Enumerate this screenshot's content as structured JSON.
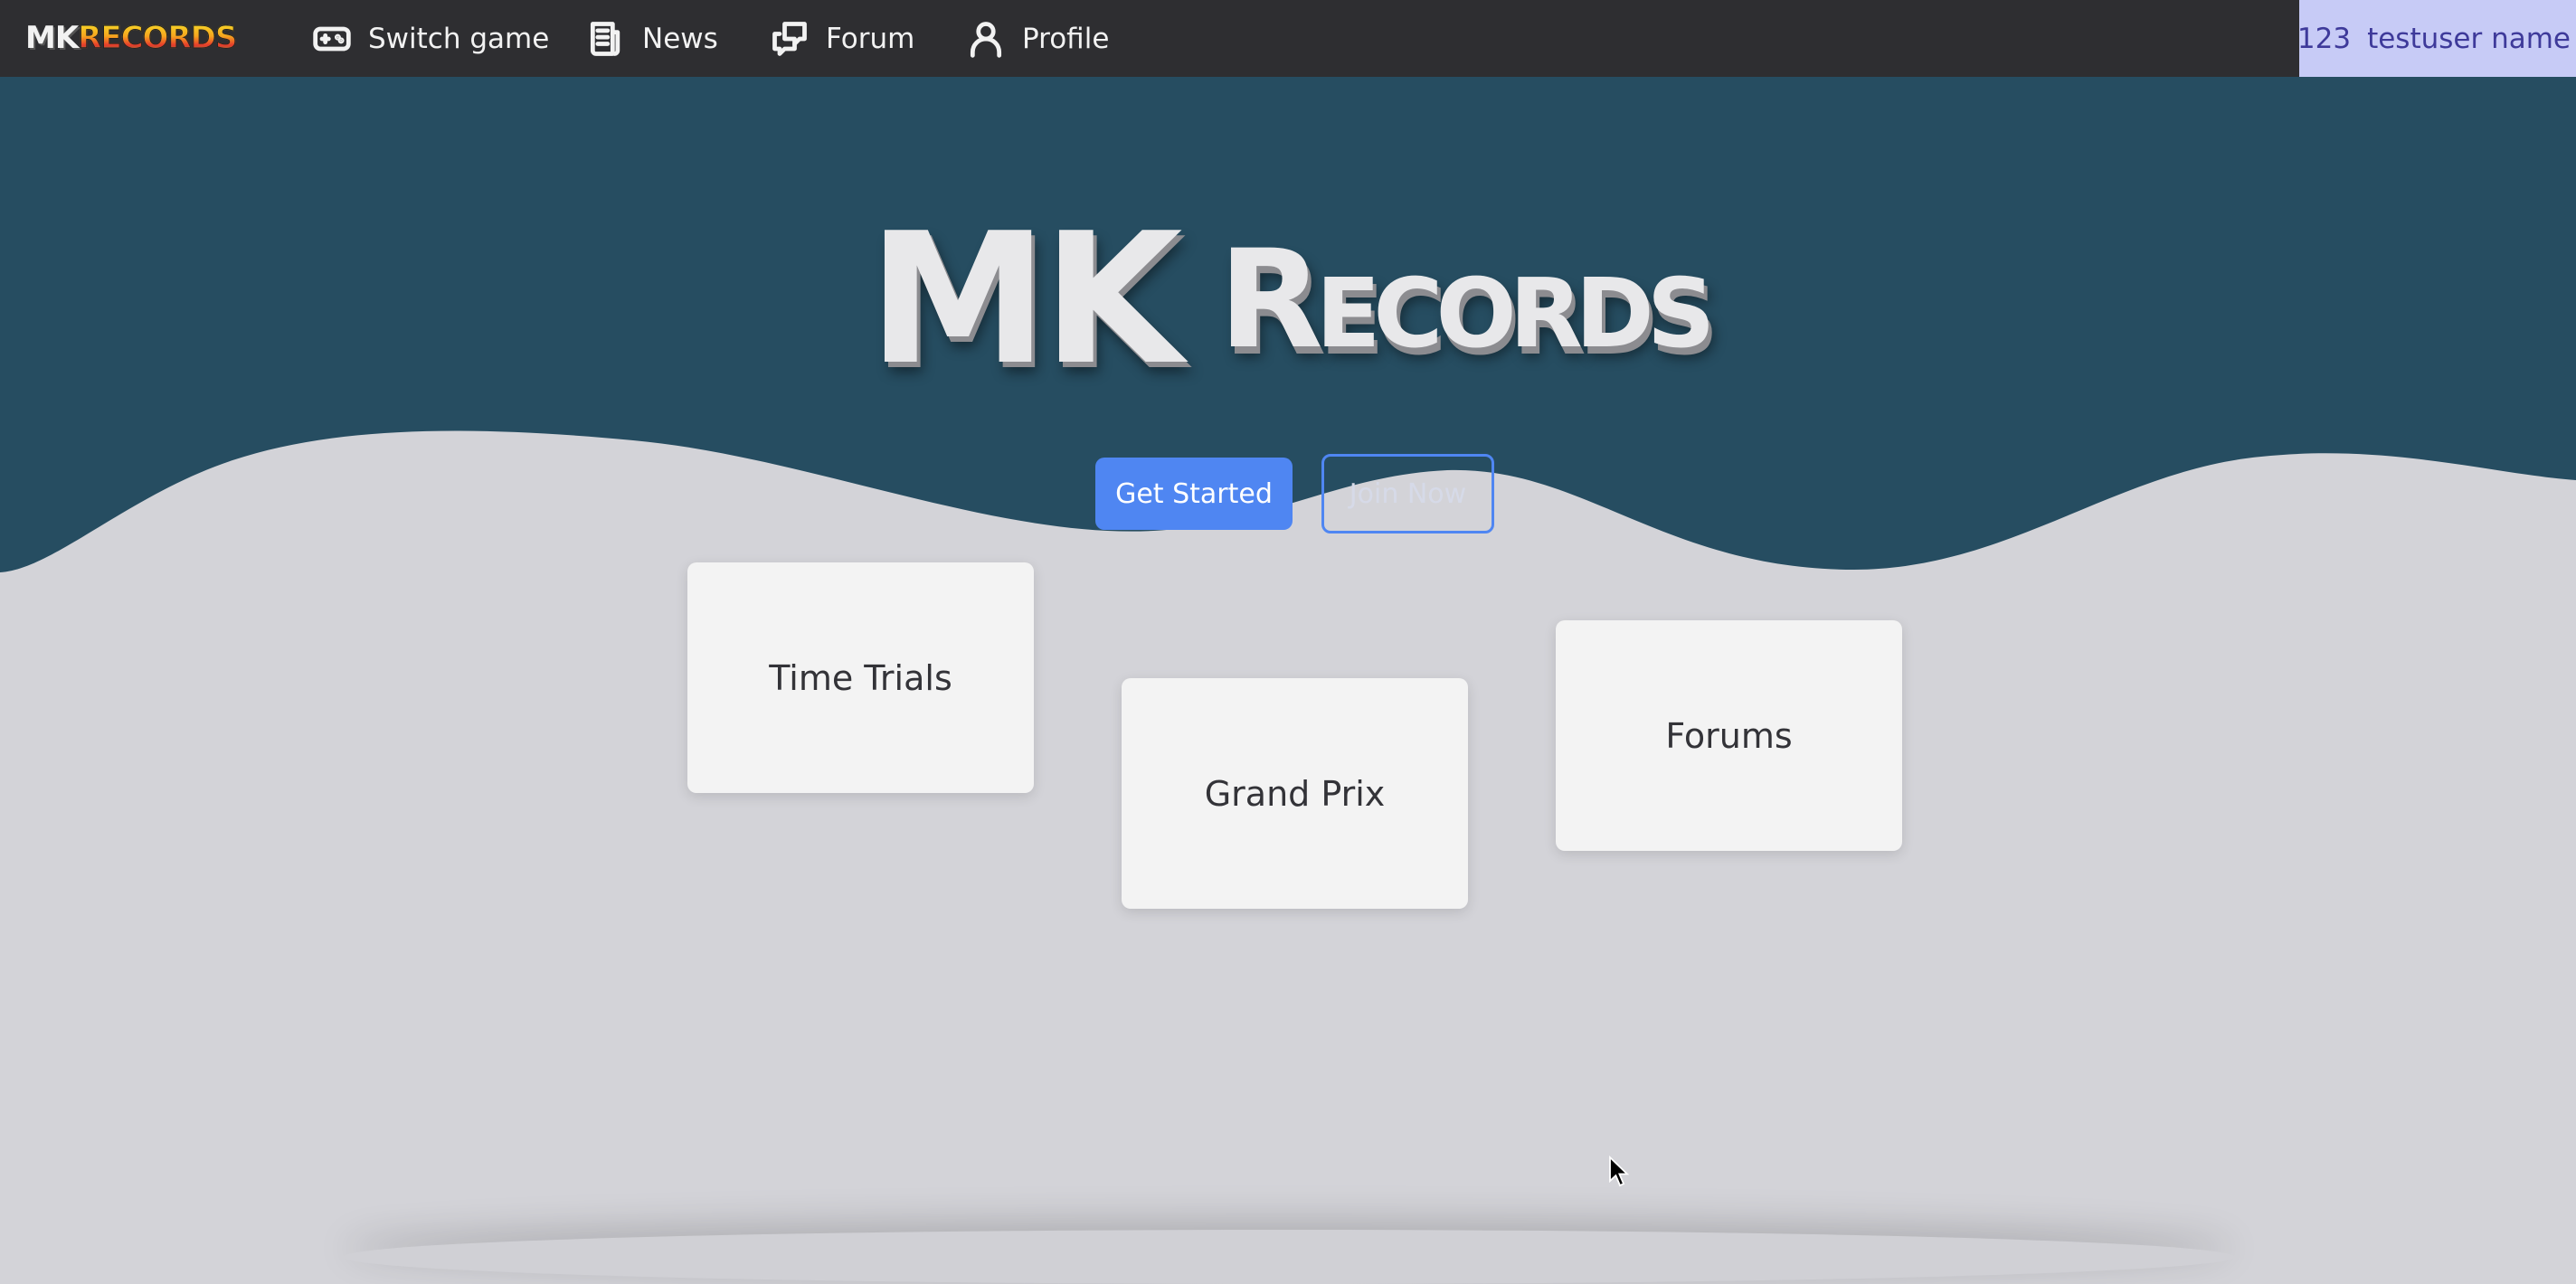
{
  "nav": {
    "logo_mk": "MK",
    "logo_records": "RECORDS",
    "items": [
      {
        "label": "Switch game",
        "icon": "gamepad-icon"
      },
      {
        "label": "News",
        "icon": "newspaper-icon"
      },
      {
        "label": "Forum",
        "icon": "chat-bubbles-icon"
      },
      {
        "label": "Profile",
        "icon": "user-icon"
      }
    ],
    "user": {
      "id": "123",
      "name": "testuser name"
    }
  },
  "hero": {
    "title_main": "MK",
    "title_sub": "Records",
    "primary_button": "Get Started",
    "secondary_button": "Join Now"
  },
  "cards": [
    {
      "label": "Time Trials"
    },
    {
      "label": "Grand Prix"
    },
    {
      "label": "Forums"
    }
  ],
  "colors": {
    "navbar": "#2e2e31",
    "hero_bg": "#264d61",
    "page_bg": "#d3d3d8",
    "accent": "#4f86f2",
    "user_badge_bg": "#c7cbf6",
    "user_badge_text": "#3e3a9a",
    "card_bg": "#f3f3f3"
  }
}
